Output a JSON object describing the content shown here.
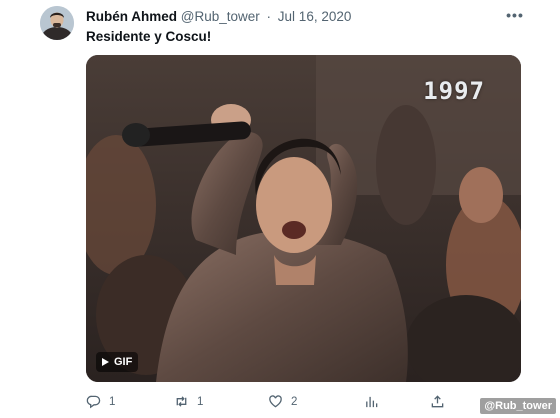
{
  "user": {
    "display_name": "Rubén Ahmed",
    "handle": "@Rub_tower",
    "separator": "·",
    "date": "Jul 16, 2020"
  },
  "tweet": {
    "text": "Residente y Coscu!"
  },
  "media": {
    "year_overlay": "1997",
    "badge_label": "GIF",
    "icon": "play-icon"
  },
  "actions": {
    "reply_count": "1",
    "retweet_count": "1",
    "like_count": "2",
    "icons": [
      "reply-icon",
      "retweet-icon",
      "heart-icon",
      "views-icon",
      "share-icon"
    ]
  },
  "more_label": "•••",
  "watermark": "@Rub_tower",
  "colors": {
    "text": "#0f1419",
    "secondary": "#536471",
    "background": "#ffffff"
  }
}
